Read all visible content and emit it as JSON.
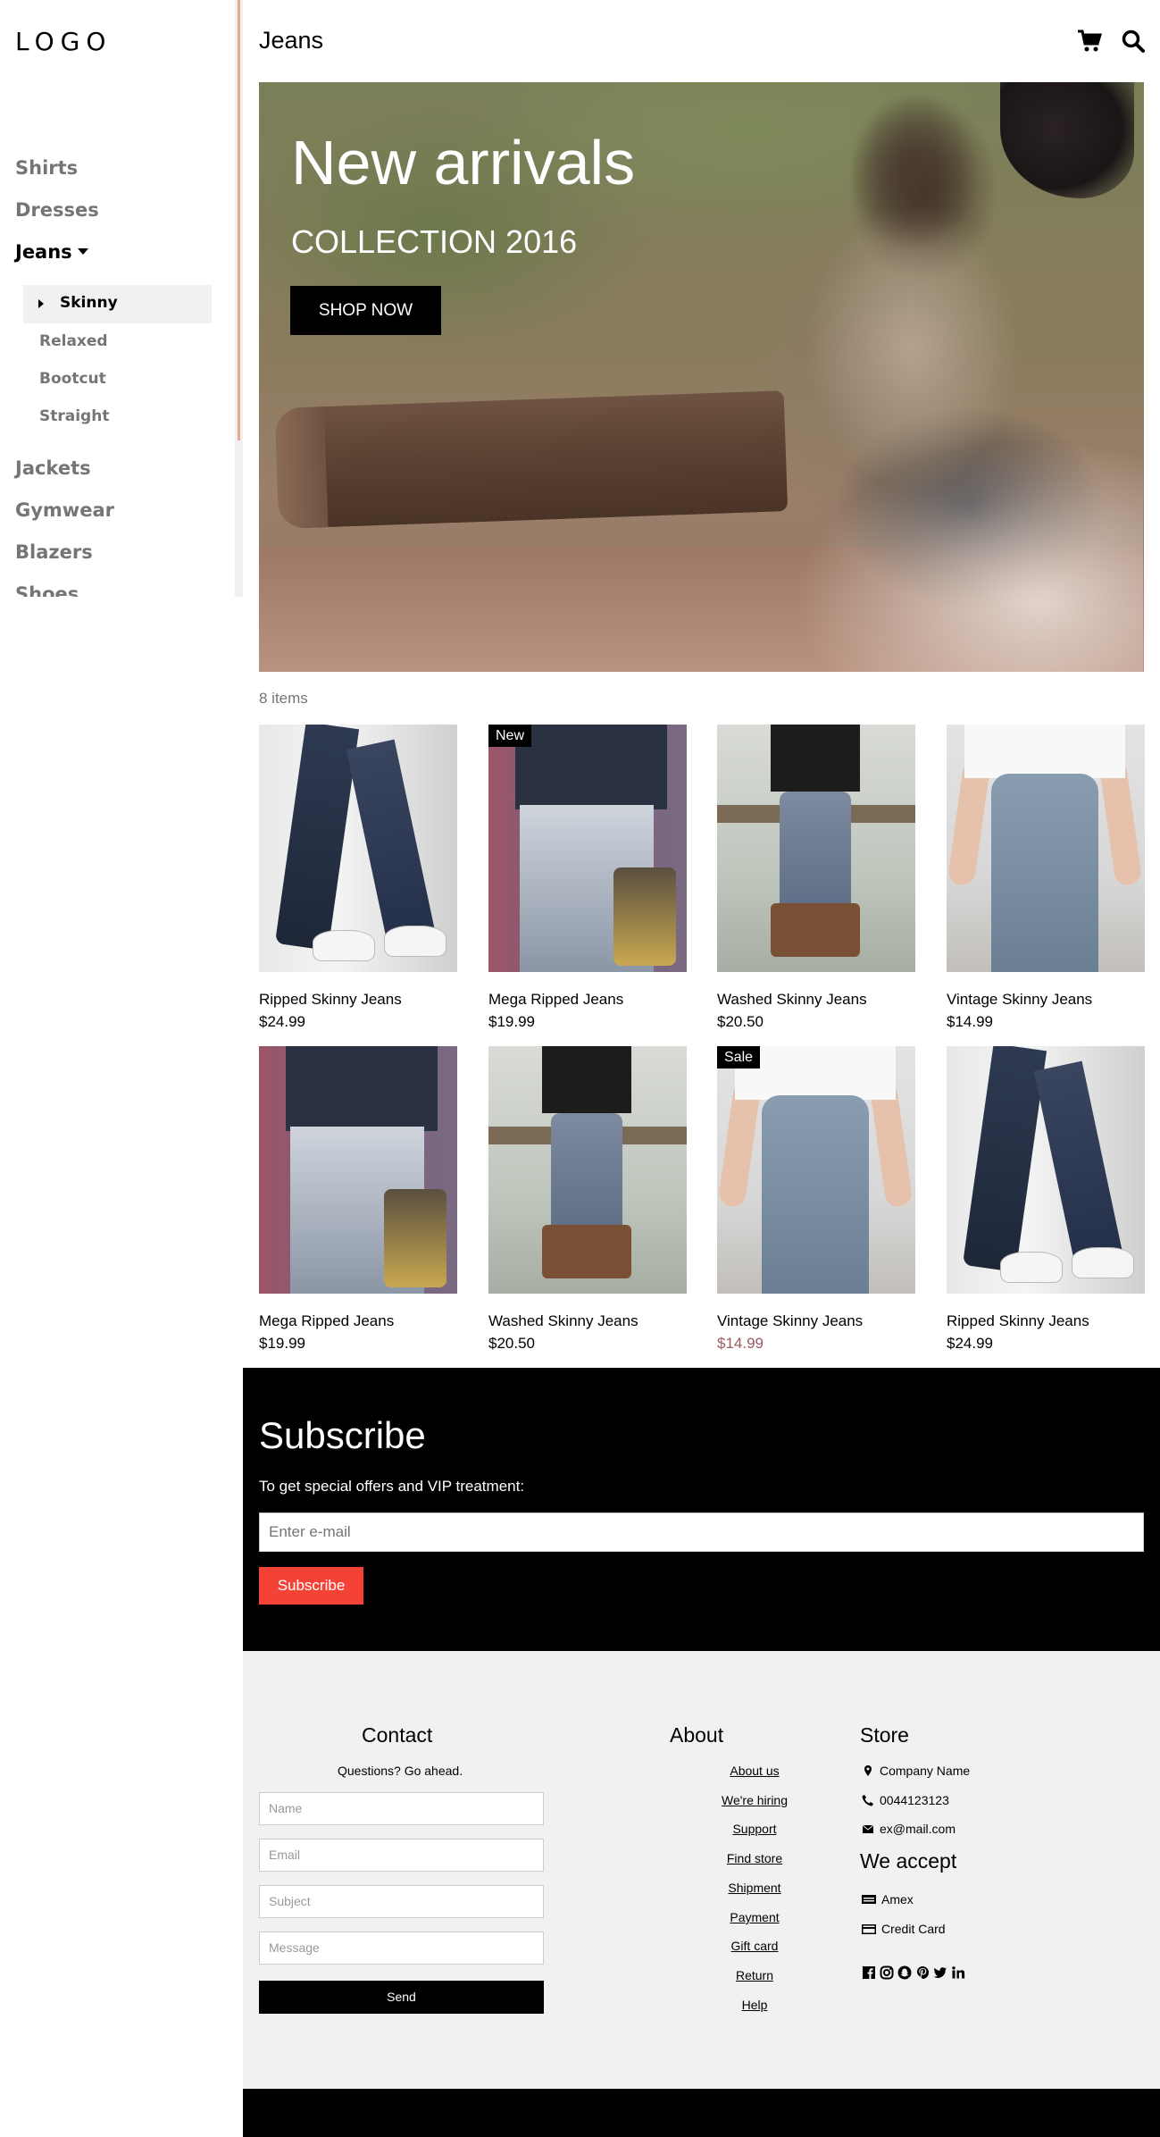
{
  "sidebar": {
    "logo": "LOGO",
    "categories": [
      "Shirts",
      "Dresses",
      "Jeans",
      "Jackets",
      "Gymwear",
      "Blazers",
      "Shoes"
    ],
    "active_category": "Jeans",
    "subcategories": [
      "Skinny",
      "Relaxed",
      "Bootcut",
      "Straight"
    ],
    "active_subcategory": "Skinny"
  },
  "header": {
    "title": "Jeans",
    "icons": [
      "cart-icon",
      "search-icon"
    ]
  },
  "hero": {
    "heading": "New arrivals",
    "subheading": "COLLECTION 2016",
    "button": "SHOP NOW"
  },
  "items": {
    "count_label": "8 items",
    "products": [
      {
        "name": "Ripped Skinny Jeans",
        "price": "$24.99",
        "tag": ""
      },
      {
        "name": "Mega Ripped Jeans",
        "price": "$19.99",
        "tag": "New"
      },
      {
        "name": "Washed Skinny Jeans",
        "price": "$20.50",
        "tag": ""
      },
      {
        "name": "Vintage Skinny Jeans",
        "price": "$14.99",
        "tag": ""
      },
      {
        "name": "Mega Ripped Jeans",
        "price": "$19.99",
        "tag": ""
      },
      {
        "name": "Washed Skinny Jeans",
        "price": "$20.50",
        "tag": ""
      },
      {
        "name": "Vintage Skinny Jeans",
        "price": "$14.99",
        "tag": "Sale"
      },
      {
        "name": "Ripped Skinny Jeans",
        "price": "$24.99",
        "tag": ""
      }
    ]
  },
  "subscribe": {
    "title": "Subscribe",
    "text": "To get special offers and VIP treatment:",
    "placeholder": "Enter e-mail",
    "button": "Subscribe"
  },
  "footer": {
    "contact": {
      "title": "Contact",
      "subtitle": "Questions? Go ahead.",
      "name_placeholder": "Name",
      "email_placeholder": "Email",
      "subject_placeholder": "Subject",
      "message_placeholder": "Message",
      "send": "Send"
    },
    "about": {
      "title": "About",
      "links": [
        "About us",
        "We're hiring",
        "Support",
        "Find store",
        "Shipment",
        "Payment",
        "Gift card",
        "Return",
        "Help"
      ]
    },
    "store": {
      "title": "Store",
      "company": "Company Name",
      "phone": "0044123123",
      "email": "ex@mail.com",
      "accept_title": "We accept",
      "payments": [
        "Amex",
        "Credit Card"
      ],
      "social": [
        "facebook-icon",
        "instagram-icon",
        "snapchat-icon",
        "pinterest-icon",
        "twitter-icon",
        "linkedin-icon"
      ]
    }
  },
  "colors": {
    "accent": "#f44336",
    "sale_price": "#9a5a5f",
    "footer_bg": "#f1f1f1",
    "scroll_thumb": "#e8a98f"
  }
}
